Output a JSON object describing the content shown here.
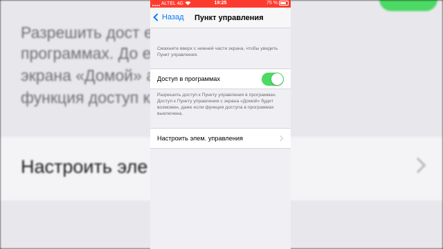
{
  "status_bar": {
    "carrier": "ALTEL 4G",
    "time": "19:25",
    "battery_text": "75 %",
    "battery_level": 0.75
  },
  "nav": {
    "back_label": "Назад",
    "title": "Пункт управления"
  },
  "caption_top": "Смахните вверх с нижней части экрана, чтобы увидеть Пункт управления.",
  "access_row": {
    "label": "Доступ в программах",
    "toggle_on": true,
    "toggle_color": "#4cd964"
  },
  "caption_access": "Разрешить доступ к Пункту управления в программах. Доступ к Пункту управления с экрана «Домой» будет возможен, даже если функция доступа в программах выключена.",
  "customize_row": {
    "label": "Настроить элем. управления"
  },
  "backdrop": {
    "lines": [
      "Разрешить дост        ения в",
      "программах. До        ения с",
      "экрана «Домой»        аже если",
      "функция доступ        ключена."
    ],
    "row_label": "Настроить эле        ния"
  },
  "colors": {
    "status_bar": "#fe3b2f",
    "accent": "#007aff",
    "background": "#efeff4"
  }
}
